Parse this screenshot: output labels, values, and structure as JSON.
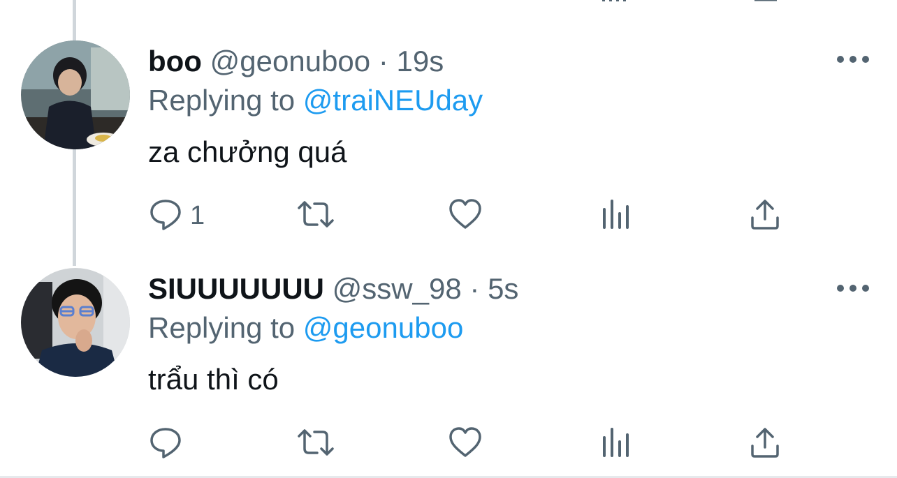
{
  "tweets": [
    {
      "name": "boo",
      "handle": "@geonuboo",
      "separator": "·",
      "time": "19s",
      "replying_label": "Replying to",
      "replying_to": "@traiNEUday",
      "text": "za chưởng quá",
      "reply_count": "1",
      "avatar": "avatar-photo-boy-eating"
    },
    {
      "name": "SIUUUUUUU",
      "handle": "@ssw_98",
      "separator": "·",
      "time": "5s",
      "replying_label": "Replying to",
      "replying_to": "@geonuboo",
      "text": "trẩu thì có",
      "reply_count": "",
      "avatar": "avatar-photo-boy-glasses"
    }
  ],
  "icons": [
    "reply-icon",
    "retweet-icon",
    "like-icon",
    "analytics-icon",
    "share-icon",
    "more-icon"
  ],
  "colors": {
    "text": "#0f1419",
    "secondary": "#536471",
    "link": "#1d9bf0",
    "thread_line": "#d0d6db"
  }
}
